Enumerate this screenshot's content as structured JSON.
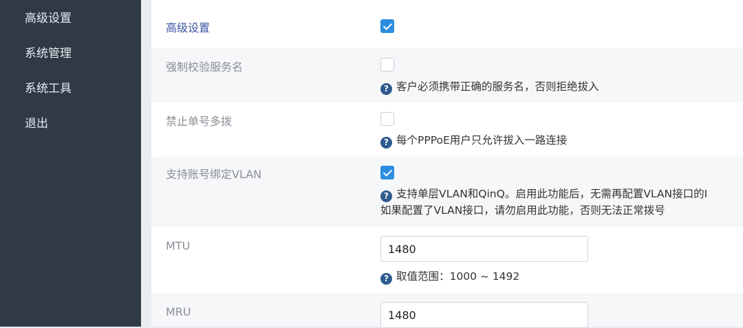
{
  "sidebar": {
    "items": [
      {
        "label": "高级设置"
      },
      {
        "label": "系统管理"
      },
      {
        "label": "系统工具"
      },
      {
        "label": "退出"
      }
    ]
  },
  "form": {
    "advanced": {
      "label": "高级设置",
      "checked": true
    },
    "force_service_name": {
      "label": "强制校验服务名",
      "checked": false,
      "help": "客户必须携带正确的服务名，否则拒绝拔入"
    },
    "disable_multi_dial": {
      "label": "禁止单号多拨",
      "checked": false,
      "help": "每个PPPoE用户只允许拔入一路连接"
    },
    "vlan_binding": {
      "label": "支持账号绑定VLAN",
      "checked": true,
      "help_line1": "支持单层VLAN和QinQ。启用此功能后，无需再配置VLAN接口的I",
      "help_line2": "如果配置了VLAN接口，请勿启用此功能，否则无法正常拨号"
    },
    "mtu": {
      "label": "MTU",
      "value": "1480",
      "help": "取值范围：1000 ~ 1492"
    },
    "mru": {
      "label": "MRU",
      "value": "1480"
    }
  },
  "icons": {
    "help": "question-circle-icon",
    "help_glyph": "?"
  },
  "colors": {
    "sidebar_bg": "#2f3a46",
    "accent": "#2d8ee0",
    "active_label": "#3f57a8",
    "help_icon": "#2e5a8e"
  }
}
